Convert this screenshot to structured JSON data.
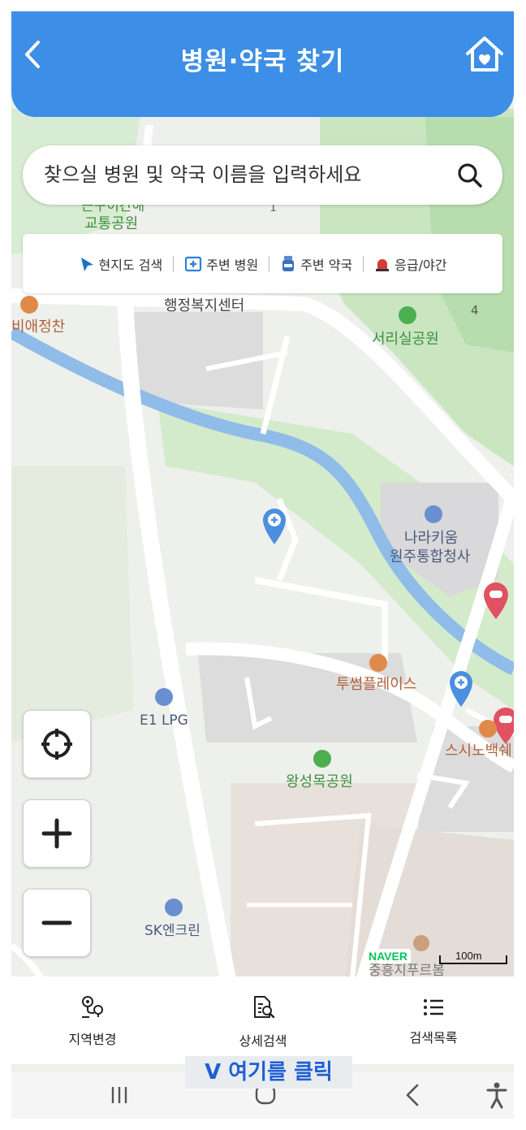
{
  "header": {
    "title": "병원·약국 찾기"
  },
  "search": {
    "placeholder": "찾으실 병원 및 약국 이름을 입력하세요"
  },
  "filters": [
    {
      "label": "현지도 검색",
      "icon": "navigation-arrow-icon",
      "color": "#1a73c8"
    },
    {
      "label": "주변 병원",
      "icon": "hospital-icon",
      "color": "#2d7fe0"
    },
    {
      "label": "주변 약국",
      "icon": "pharmacy-icon",
      "color": "#3a6fc4"
    },
    {
      "label": "응급/야간",
      "icon": "siren-icon",
      "color": "#d63b3b"
    }
  ],
  "map": {
    "labels": {
      "park_top": "교통공원",
      "cutoff_top": "근구이간해",
      "restaurant_left": "비애정찬",
      "admin_center": "행정복지센터",
      "seori_park": "서리실공원",
      "naraki_1": "나라키움",
      "naraki_2": "원주통합청사",
      "cafe": "투썸플레이스",
      "e1": "E1 LPG",
      "sushi": "스시노백쉐",
      "wangseong": "왕성목공원",
      "sk": "SK엔크린",
      "apartment": "중흥지푸르봄",
      "num1": "1",
      "num4": "4"
    },
    "attribution": "NAVER",
    "scale": "100m"
  },
  "controls": {
    "locate": "crosshair-icon",
    "zoom_in": "plus-icon",
    "zoom_out": "minus-icon"
  },
  "bottom_nav": [
    {
      "label": "지역변경",
      "icon": "map-pins-icon"
    },
    {
      "label": "상세검색",
      "icon": "document-search-icon"
    },
    {
      "label": "검색목록",
      "icon": "list-icon"
    }
  ],
  "hint": "V 여기를 클릭",
  "colors": {
    "header": "#3c8ee6",
    "hint_text": "#1f5fd3",
    "river": "#8fbce8",
    "park": "#cbe8c3"
  }
}
